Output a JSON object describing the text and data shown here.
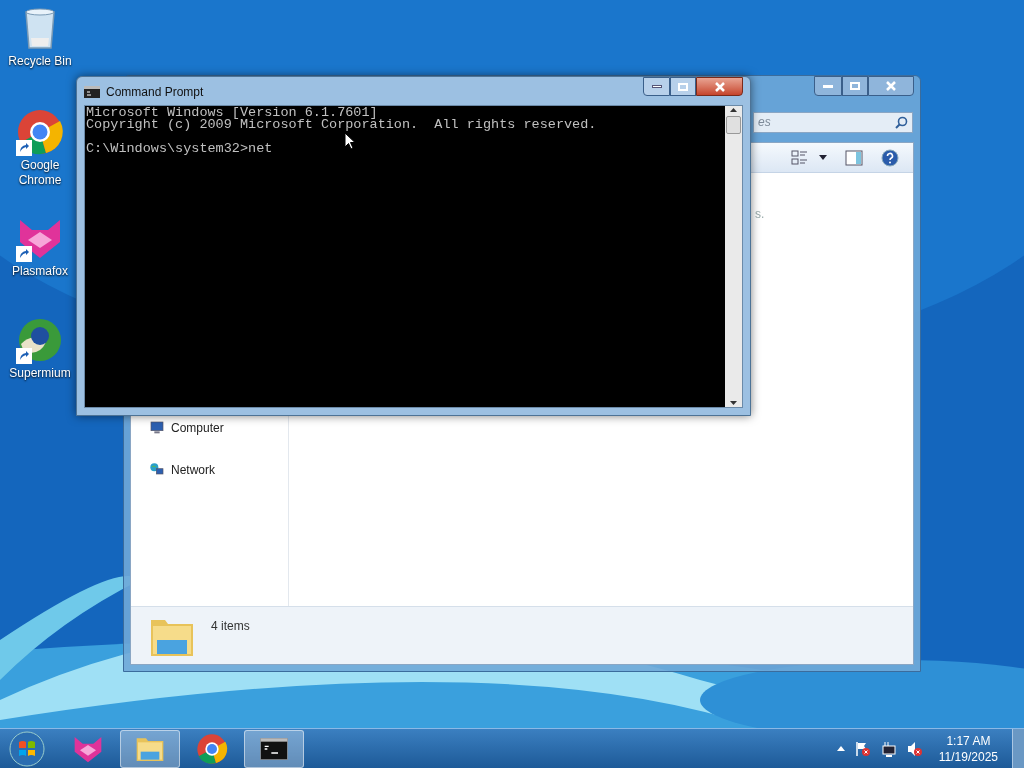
{
  "desktop_icons": [
    {
      "label": "Recycle Bin",
      "kind": "bin",
      "shortcut": false
    },
    {
      "label": "Google Chrome",
      "kind": "chrome",
      "shortcut": true
    },
    {
      "label": "Plasmafox",
      "kind": "fox",
      "shortcut": true
    },
    {
      "label": "Supermium",
      "kind": "supermium",
      "shortcut": true
    }
  ],
  "explorer": {
    "search_placeholder": "es",
    "content_fragment": "s.",
    "nav_items": [
      {
        "label": "Computer",
        "kind": "computer"
      },
      {
        "label": "Network",
        "kind": "network"
      }
    ],
    "status": "4 items"
  },
  "cmd": {
    "title": "Command Prompt",
    "lines": [
      "Microsoft Windows [Version 6.1.7601]",
      "Copyright (c) 2009 Microsoft Corporation.  All rights reserved."
    ],
    "prompt": "C:\\Windows\\system32>net"
  },
  "taskbar": {
    "items": [
      {
        "kind": "fox",
        "open": false
      },
      {
        "kind": "folder",
        "open": true
      },
      {
        "kind": "chrome",
        "open": false
      },
      {
        "kind": "cmd",
        "open": true
      }
    ],
    "clock": {
      "time": "1:17 AM",
      "date": "11/19/2025"
    }
  }
}
